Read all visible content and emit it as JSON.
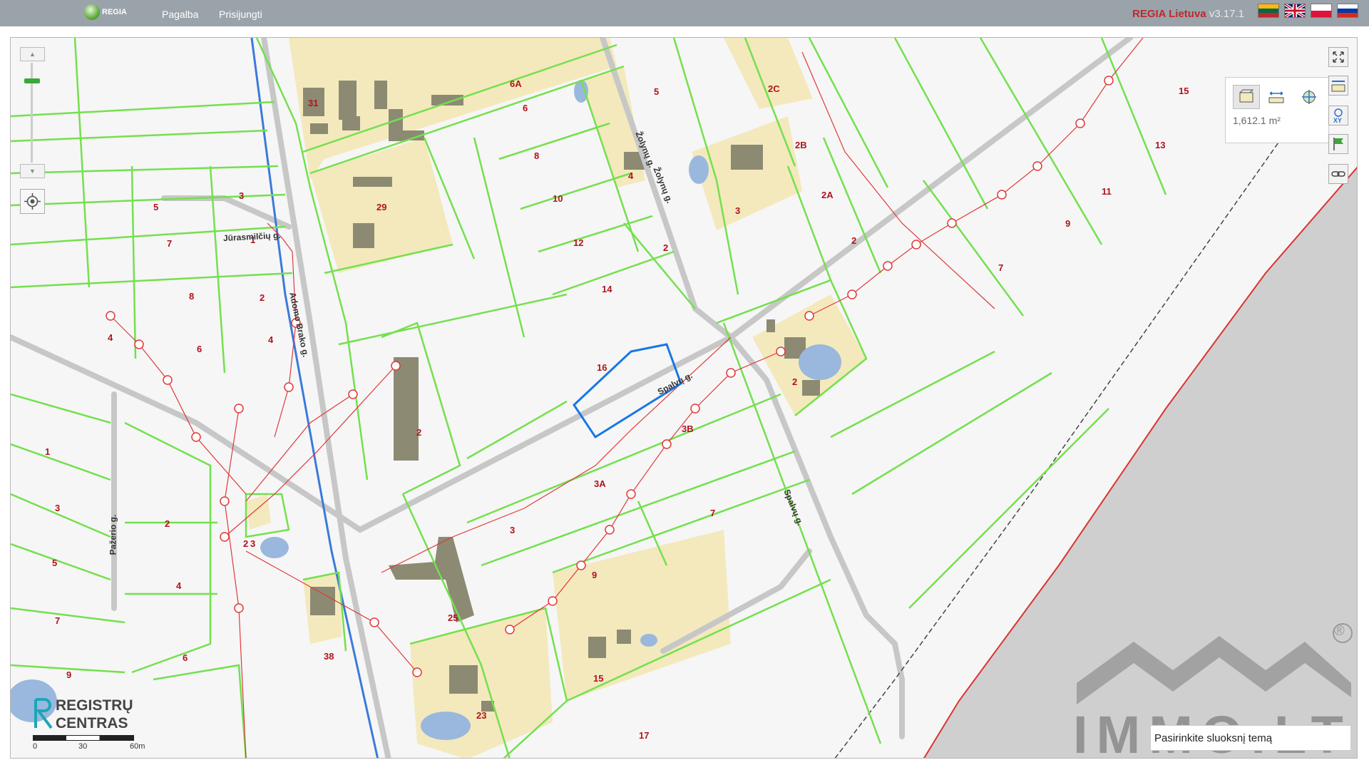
{
  "topbar": {
    "logo_text": "REGIA",
    "nav": [
      "Pagalba",
      "Prisijungti"
    ],
    "brand": "REGIA Lietuva",
    "version": "v3.17.1",
    "languages": [
      "lt-flag-icon",
      "en-flag-icon",
      "pl-flag-icon",
      "ru-flag-icon"
    ]
  },
  "colors": {
    "parcel_line": "#74e04e",
    "building_area": "#f3e9bd",
    "building": "#8c8a72",
    "road": "#bfbfbf",
    "utility_line": "#e0393a",
    "selected_parcel": "#1877e6",
    "water": "#9ab8dd",
    "river": "#3b7ad9",
    "boundary_area": "#cfcfcf"
  },
  "map": {
    "parcel_labels": [
      "31",
      "6A",
      "6",
      "5",
      "2C",
      "15",
      "13",
      "3",
      "5",
      "7",
      "1",
      "29",
      "8",
      "4",
      "10",
      "12",
      "2",
      "2B",
      "2A",
      "3",
      "2",
      "11",
      "9",
      "7",
      "8",
      "2",
      "4",
      "6",
      "14",
      "16",
      "2",
      "4",
      "1",
      "3",
      "5",
      "7",
      "9",
      "2",
      "4",
      "6",
      "2",
      "3B",
      "3A",
      "3",
      "7",
      "9",
      "25",
      "38",
      "23",
      "15",
      "17",
      "16",
      "3",
      "2"
    ],
    "street_labels": [
      "Jūrasmilčių g.",
      "Adomo Brako g.",
      "Žolynų g.",
      "Žolynų g.",
      "Spalvų g.",
      "Spalvų g.",
      "Pažerio g."
    ],
    "selected_parcel_label": "3B"
  },
  "measure_panel": {
    "area": "1,612.1 m²",
    "tools": [
      "measure-area-icon",
      "measure-length-icon",
      "coordinate-icon"
    ]
  },
  "right_tools": [
    "fullscreen-icon",
    "measure-icon",
    "xy-coordinates-icon",
    "flag-icon",
    "link-icon"
  ],
  "layer_select": {
    "placeholder": "Pasirinkite sluoksnį temą"
  },
  "logo_rc": {
    "line1": "REGISTRŲ",
    "line2": "CENTRAS"
  },
  "scale": {
    "labels": [
      "0",
      "30",
      "60m"
    ]
  },
  "watermark": {
    "text": "IMMO.LT",
    "reg": "®"
  }
}
